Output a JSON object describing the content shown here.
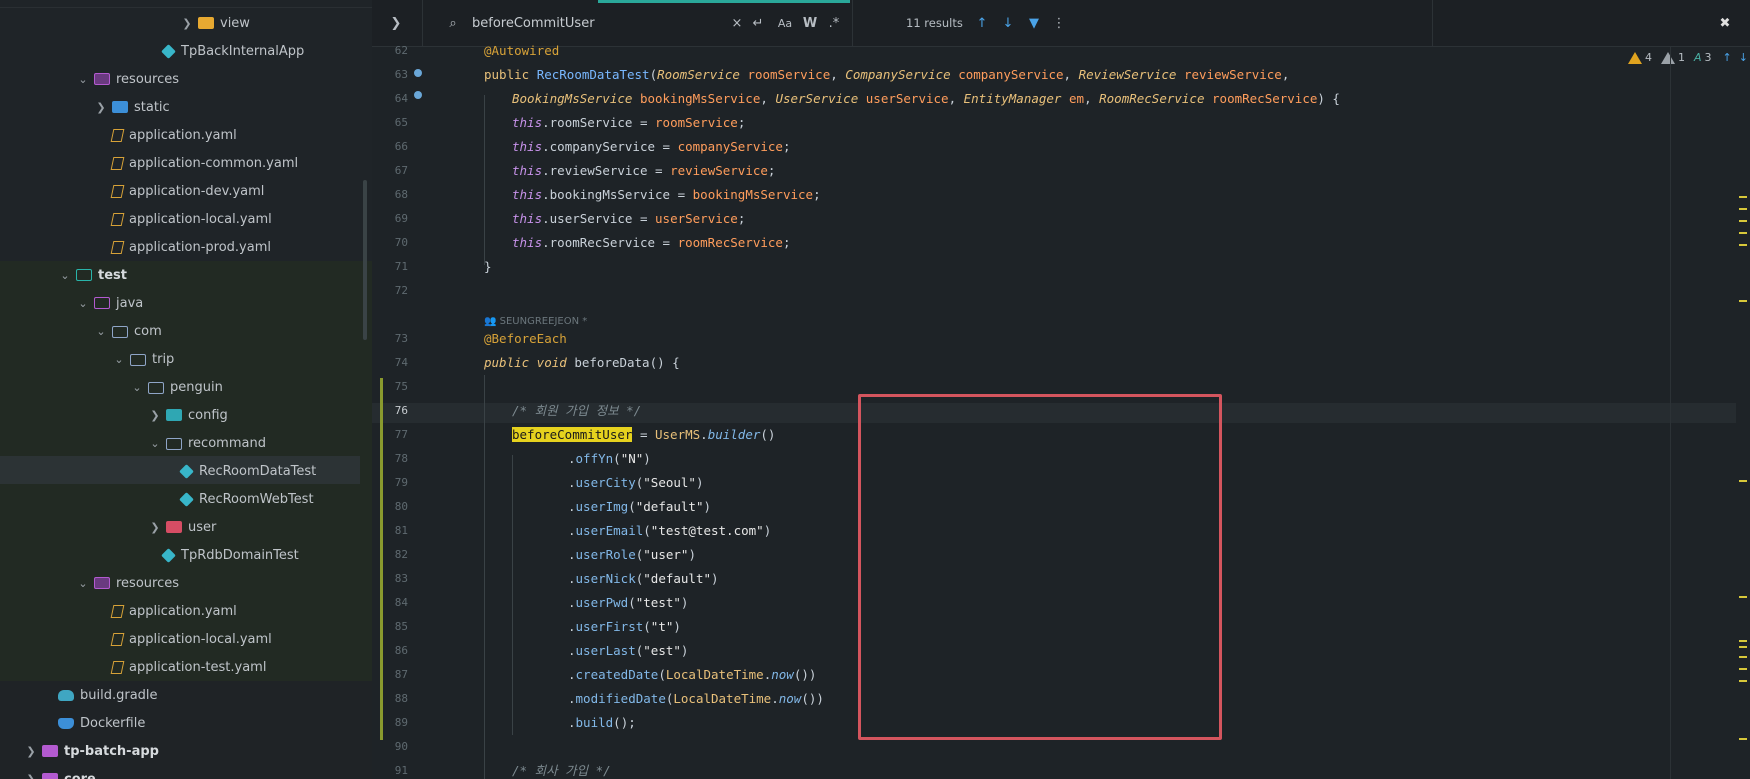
{
  "tree": {
    "items": [
      {
        "label": "view",
        "depth": 8
      },
      {
        "label": "TpBackInternalApp",
        "depth": 7
      },
      {
        "label": "resources",
        "depth": 4
      },
      {
        "label": "static",
        "depth": 5
      },
      {
        "label": "application.yaml",
        "depth": 5
      },
      {
        "label": "application-common.yaml",
        "depth": 5
      },
      {
        "label": "application-dev.yaml",
        "depth": 5
      },
      {
        "label": "application-local.yaml",
        "depth": 5
      },
      {
        "label": "application-prod.yaml",
        "depth": 5
      },
      {
        "label": "test",
        "depth": 3
      },
      {
        "label": "java",
        "depth": 4
      },
      {
        "label": "com",
        "depth": 5
      },
      {
        "label": "trip",
        "depth": 6
      },
      {
        "label": "penguin",
        "depth": 7
      },
      {
        "label": "config",
        "depth": 8
      },
      {
        "label": "recommand",
        "depth": 8
      },
      {
        "label": "RecRoomDataTest",
        "depth": 9
      },
      {
        "label": "RecRoomWebTest",
        "depth": 9
      },
      {
        "label": "user",
        "depth": 8
      },
      {
        "label": "TpRdbDomainTest",
        "depth": 8
      },
      {
        "label": "resources",
        "depth": 4
      },
      {
        "label": "application.yaml",
        "depth": 5
      },
      {
        "label": "application-local.yaml",
        "depth": 5
      },
      {
        "label": "application-test.yaml",
        "depth": 5
      },
      {
        "label": "build.gradle",
        "depth": 3
      },
      {
        "label": "Dockerfile",
        "depth": 3
      },
      {
        "label": "tp-batch-app",
        "depth": 1
      },
      {
        "label": "core",
        "depth": 1
      }
    ]
  },
  "find": {
    "query": "beforeCommitUser",
    "results": "11 results",
    "match_case": "Aa",
    "words": "W",
    "regex": ".*"
  },
  "inspections": {
    "warnings": "4",
    "weak_warnings": "1",
    "typos": "3"
  },
  "lines": [
    "62",
    "63",
    "64",
    "65",
    "66",
    "67",
    "68",
    "69",
    "70",
    "71",
    "72",
    "",
    "73",
    "74",
    "75",
    "76",
    "77",
    "78",
    "79",
    "80",
    "81",
    "82",
    "83",
    "84",
    "85",
    "86",
    "87",
    "88",
    "89",
    "90",
    "91"
  ],
  "code": {
    "author": "SEUNGREEJEON *",
    "l62": "@Autowired",
    "l63_public": "public",
    "l63_ctor": "RecRoomDataTest",
    "l63_rest": [
      "RoomService",
      "roomService",
      "CompanyService",
      "companyService",
      "ReviewService",
      "reviewService"
    ],
    "l64": [
      "BookingMsService",
      "bookingMsService",
      "UserService",
      "userService",
      "EntityManager",
      "em",
      "RoomRecService",
      "roomRecService"
    ],
    "assign": [
      {
        "field": "roomService",
        "param": "roomService"
      },
      {
        "field": "companyService",
        "param": "companyService"
      },
      {
        "field": "reviewService",
        "param": "reviewService"
      },
      {
        "field": "bookingMsService",
        "param": "bookingMsService"
      },
      {
        "field": "userService",
        "param": "userService"
      },
      {
        "field": "roomRecService",
        "param": "roomRecService"
      }
    ],
    "before_each": "@BeforeEach",
    "public_void": "public void",
    "before_data": "beforeData",
    "comment1": "/* 회원 가입 정보 */",
    "var": "beforeCommitUser",
    "builder_cls": "UserMS",
    "builder_m": "builder",
    "calls": [
      {
        "m": "offYn",
        "a": "\"N\""
      },
      {
        "m": "userCity",
        "a": "\"Seoul\""
      },
      {
        "m": "userImg",
        "a": "\"default\""
      },
      {
        "m": "userEmail",
        "a": "\"test@test.com\""
      },
      {
        "m": "userRole",
        "a": "\"user\""
      },
      {
        "m": "userNick",
        "a": "\"default\""
      },
      {
        "m": "userPwd",
        "a": "\"test\""
      },
      {
        "m": "userFirst",
        "a": "\"t\""
      },
      {
        "m": "userLast",
        "a": "\"est\""
      }
    ],
    "created": "createdDate",
    "modified": "modifiedDate",
    "ldt": "LocalDateTime",
    "now": "now",
    "build": "build",
    "comment2": "/* 회사 가입 */"
  }
}
